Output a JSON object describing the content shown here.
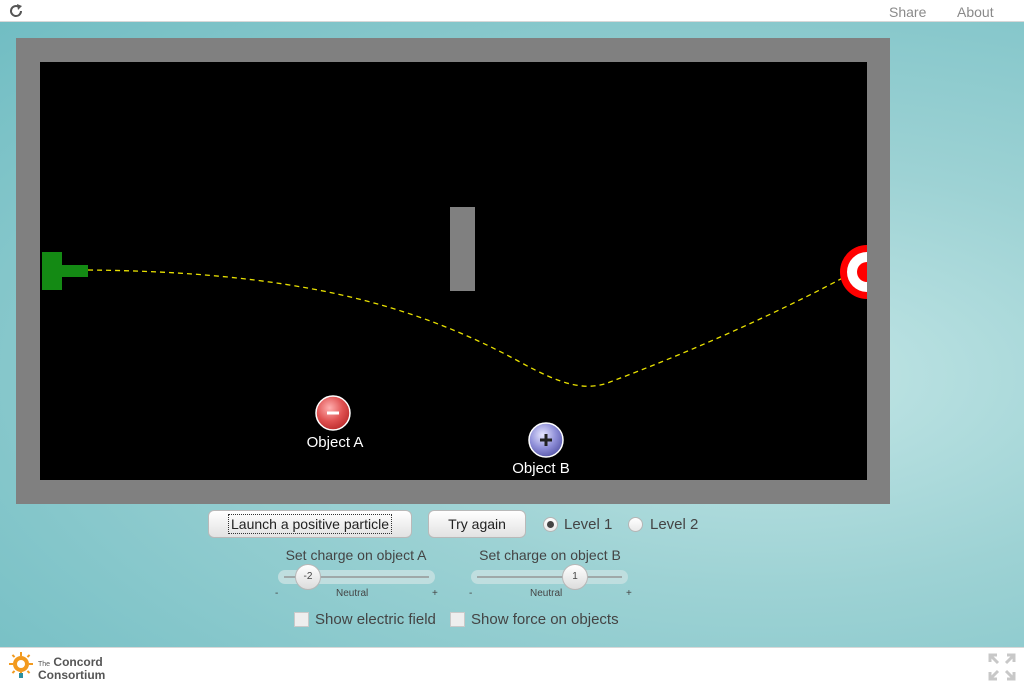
{
  "topbar": {
    "share": "Share",
    "about": "About"
  },
  "stage": {
    "object_a": {
      "label": "Object A",
      "sign": "-"
    },
    "object_b": {
      "label": "Object B",
      "sign": "+"
    }
  },
  "controls": {
    "launch_button": "Launch a positive particle",
    "try_again_button": "Try again",
    "level1_label": "Level 1",
    "level2_label": "Level 2",
    "selected_level": "Level 1",
    "slider_a": {
      "title": "Set charge on object A",
      "value": "-2",
      "min_label": "-",
      "mid_label": "Neutral",
      "max_label": "+"
    },
    "slider_b": {
      "title": "Set charge on object B",
      "value": "1",
      "min_label": "-",
      "mid_label": "Neutral",
      "max_label": "+"
    },
    "show_field_label": "Show electric field",
    "show_force_label": "Show force on objects"
  },
  "footer": {
    "logo_small": "The",
    "logo_line1": "Concord",
    "logo_line2": "Consortium"
  },
  "colors": {
    "launcher": "#148a14",
    "target_red": "#ff0000",
    "trajectory": "#e8e000",
    "negative_object": "#e05252",
    "positive_object": "#8f8fd8",
    "background": "#9dd2d4"
  }
}
